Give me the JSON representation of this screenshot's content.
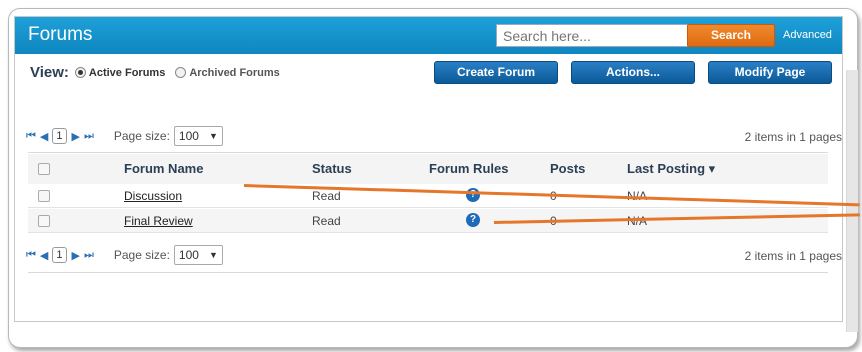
{
  "header": {
    "title": "Forums",
    "search_placeholder": "Search here...",
    "search_label": "Search",
    "advanced_label": "Advanced"
  },
  "view": {
    "label": "View:",
    "options": [
      {
        "label": "Active Forums",
        "checked": true
      },
      {
        "label": "Archived Forums",
        "checked": false
      }
    ]
  },
  "actions": {
    "create_forum": "Create Forum",
    "actions": "Actions...",
    "modify_page": "Modify Page"
  },
  "pager": {
    "current_page": "1",
    "page_size_label": "Page size:",
    "page_size": "100",
    "items_summary": "2 items in 1 pages"
  },
  "table": {
    "columns": [
      "Forum Name",
      "Status",
      "Forum Rules",
      "Posts",
      "Last Posting"
    ],
    "sort_indicator": "▾",
    "rows": [
      {
        "name": "Discussion",
        "status": "Read",
        "rules_icon": "help-icon",
        "posts": "0",
        "last_posting": "N/A"
      },
      {
        "name": "Final Review",
        "status": "Read",
        "rules_icon": "help-icon",
        "posts": "0",
        "last_posting": "N/A"
      }
    ]
  },
  "colors": {
    "header_blue": "#1ea0d9",
    "search_orange": "#f08a2e",
    "button_blue": "#0b5a99",
    "annotation_orange": "#e6762a"
  }
}
